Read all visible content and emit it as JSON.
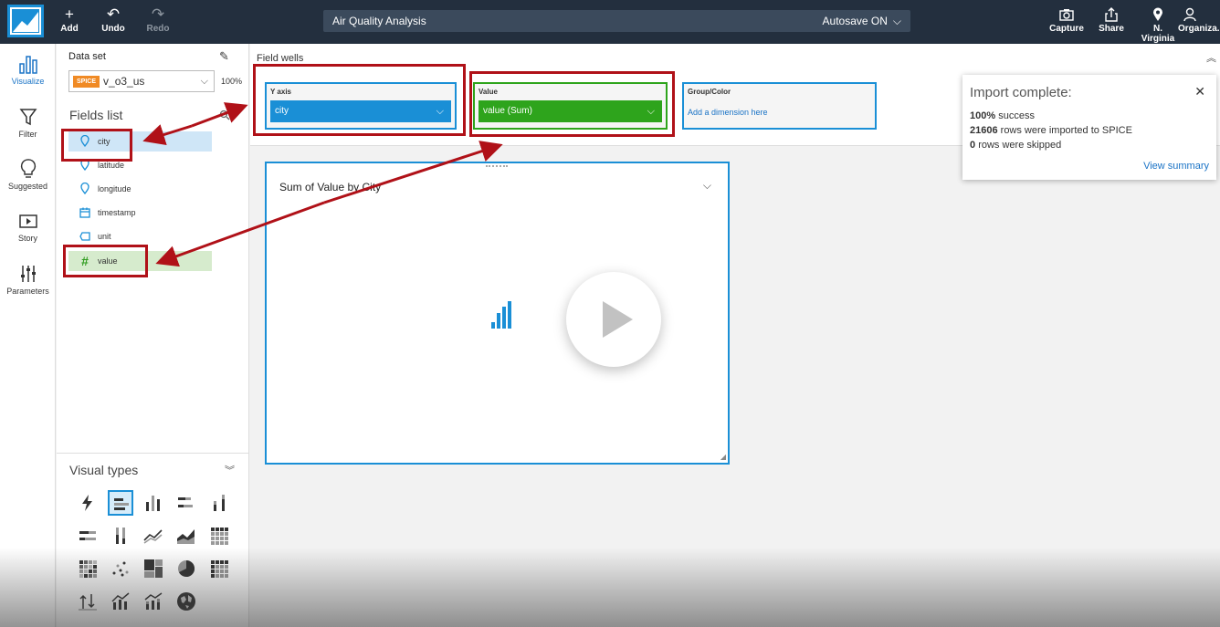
{
  "toolbar": {
    "add_label": "Add",
    "undo_label": "Undo",
    "redo_label": "Redo",
    "analysis_title": "Air Quality Analysis",
    "autosave_label": "Autosave ON",
    "capture_label": "Capture",
    "share_label": "Share",
    "region_label": "N. Virginia",
    "account_label": "Organiza..."
  },
  "rail": {
    "items": [
      {
        "label": "Visualize",
        "icon": "bar-chart-icon"
      },
      {
        "label": "Filter",
        "icon": "funnel-icon"
      },
      {
        "label": "Suggested",
        "icon": "lightbulb-icon"
      },
      {
        "label": "Story",
        "icon": "story-icon"
      },
      {
        "label": "Parameters",
        "icon": "sliders-icon"
      }
    ]
  },
  "dataset": {
    "label": "Data set",
    "badge": "SPICE",
    "name": "v_o3_us",
    "percent": "100%"
  },
  "fields_list": {
    "title": "Fields list",
    "fields": [
      {
        "name": "city",
        "type": "geo"
      },
      {
        "name": "latitude",
        "type": "geo"
      },
      {
        "name": "longitude",
        "type": "geo"
      },
      {
        "name": "timestamp",
        "type": "date"
      },
      {
        "name": "unit",
        "type": "text"
      },
      {
        "name": "value",
        "type": "number"
      }
    ]
  },
  "visual_types": {
    "title": "Visual types"
  },
  "field_wells": {
    "title": "Field wells",
    "y_axis": {
      "label": "Y axis",
      "value": "city"
    },
    "value": {
      "label": "Value",
      "value": "value (Sum)"
    },
    "group": {
      "label": "Group/Color",
      "placeholder": "Add a dimension here"
    }
  },
  "visual": {
    "title": "Sum of Value by City"
  },
  "toast": {
    "title": "Import complete:",
    "success_pct": "100%",
    "success_text": "success",
    "rows_imported": "21606",
    "rows_imported_text": "rows were imported to SPICE",
    "rows_skipped": "0",
    "rows_skipped_text": "rows were skipped",
    "link": "View summary"
  },
  "colors": {
    "topbar": "#232f3e",
    "accent_blue": "#1a8fd6",
    "measure_green": "#2ea41c",
    "spice_orange": "#f08a24",
    "annotation_red": "#b01118"
  }
}
